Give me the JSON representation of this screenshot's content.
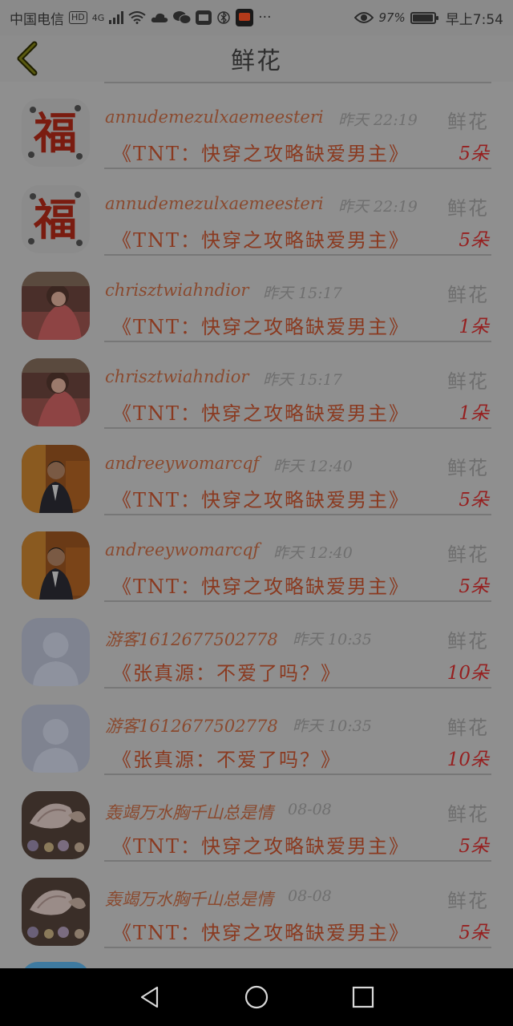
{
  "status_bar": {
    "carrier": "中国电信",
    "hd_badge": "HD",
    "network": "4G",
    "battery_percent": "97%",
    "battery_level": 0.97,
    "time": "早上7:54",
    "more": "···",
    "icons": [
      "signal-icon",
      "wifi-icon",
      "cloud-icon",
      "wechat-icon",
      "huawei-icon",
      "bluetooth-icon",
      "video-app-icon",
      "eye-icon"
    ]
  },
  "header": {
    "title": "鲜花",
    "back_icon": "chevron-left-icon"
  },
  "records": [
    {
      "user": "annudemezulxaemeesteri",
      "time": "昨天 22:19",
      "type": "鲜花",
      "book": "《TNT：快穿之攻略缺爱男主》",
      "count": "5朵",
      "avatar": "fu-character"
    },
    {
      "user": "annudemezulxaemeesteri",
      "time": "昨天 22:19",
      "type": "鲜花",
      "book": "《TNT：快穿之攻略缺爱男主》",
      "count": "5朵",
      "avatar": "fu-character"
    },
    {
      "user": "chrisztwiahndior",
      "time": "昨天 15:17",
      "type": "鲜花",
      "book": "《TNT：快穿之攻略缺爱男主》",
      "count": "1朵",
      "avatar": "girl-photo"
    },
    {
      "user": "chrisztwiahndior",
      "time": "昨天 15:17",
      "type": "鲜花",
      "book": "《TNT：快穿之攻略缺爱男主》",
      "count": "1朵",
      "avatar": "girl-photo"
    },
    {
      "user": "andreeywomarcqf",
      "time": "昨天 12:40",
      "type": "鲜花",
      "book": "《TNT：快穿之攻略缺爱男主》",
      "count": "5朵",
      "avatar": "man-suit-photo"
    },
    {
      "user": "andreeywomarcqf",
      "time": "昨天 12:40",
      "type": "鲜花",
      "book": "《TNT：快穿之攻略缺爱男主》",
      "count": "5朵",
      "avatar": "man-suit-photo"
    },
    {
      "user": "游客1612677502778",
      "time": "昨天 10:35",
      "type": "鲜花",
      "book": "《张真源：不爱了吗？》",
      "count": "10朵",
      "avatar": "default-person"
    },
    {
      "user": "游客1612677502778",
      "time": "昨天 10:35",
      "type": "鲜花",
      "book": "《张真源：不爱了吗？》",
      "count": "10朵",
      "avatar": "default-person"
    },
    {
      "user": "轰竭万水胸千山总是情",
      "time": "08-08",
      "type": "鲜花",
      "book": "《TNT：快穿之攻略缺爱男主》",
      "count": "5朵",
      "avatar": "seashells-photo"
    },
    {
      "user": "轰竭万水胸千山总是情",
      "time": "08-08",
      "type": "鲜花",
      "book": "《TNT：快穿之攻略缺爱男主》",
      "count": "5朵",
      "avatar": "seashells-photo"
    }
  ],
  "nav_bar": {
    "back_icon": "nav-back-icon",
    "home_icon": "nav-home-icon",
    "recents_icon": "nav-recents-icon"
  }
}
